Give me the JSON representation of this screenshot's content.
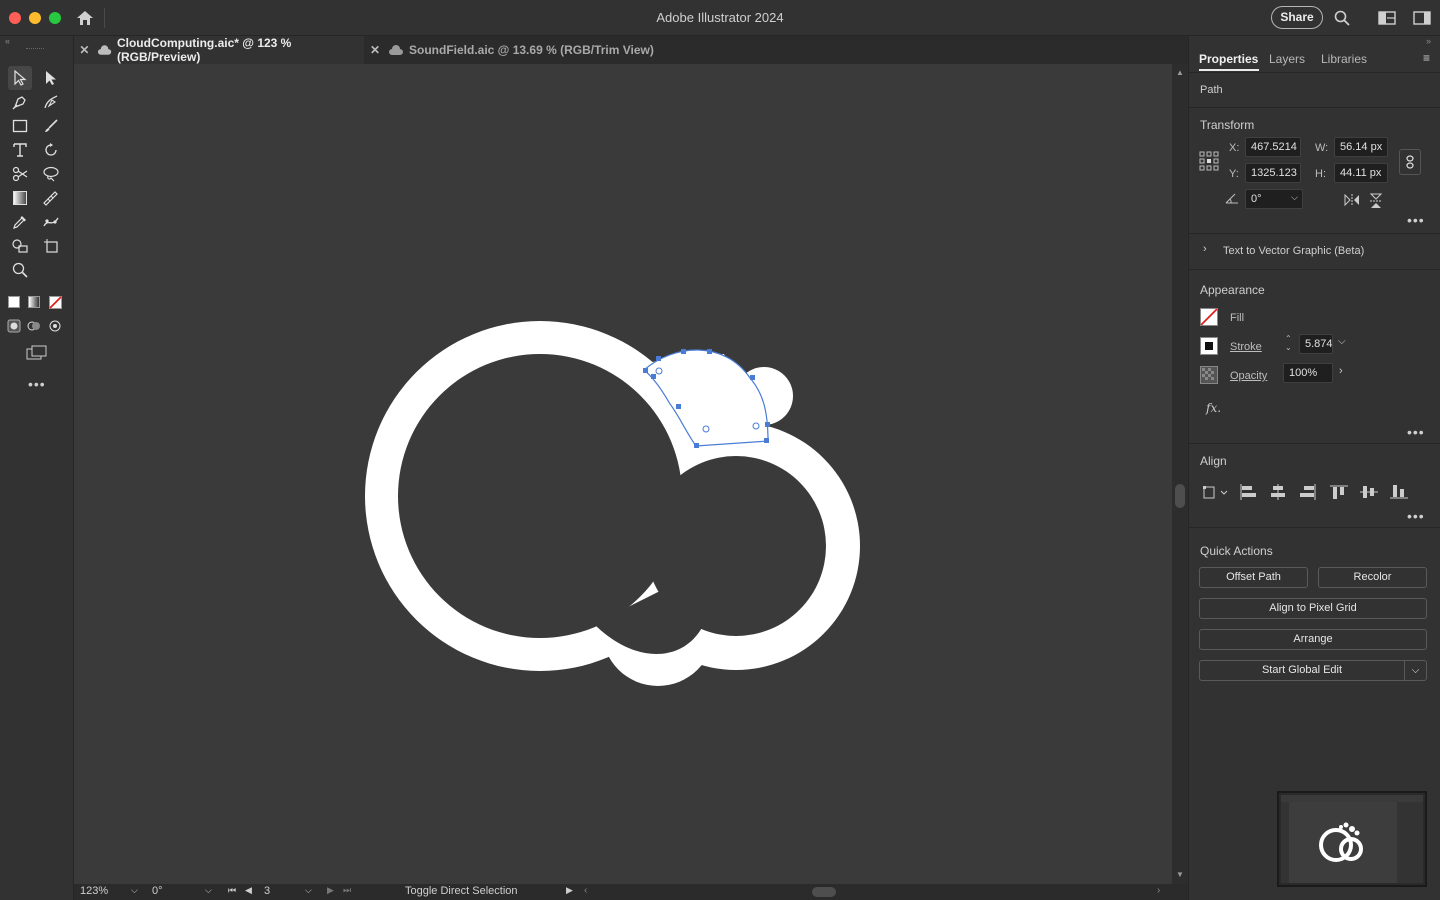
{
  "window": {
    "title": "Adobe Illustrator 2024",
    "share_label": "Share"
  },
  "tabs": [
    {
      "label": "CloudComputing.aic* @ 123 % (RGB/Preview)",
      "active": true
    },
    {
      "label": "SoundField.aic @ 13.69 % (RGB/Trim View)",
      "active": false
    }
  ],
  "panel": {
    "tabs": [
      "Properties",
      "Layers",
      "Libraries"
    ],
    "selection_type": "Path",
    "transform": {
      "title": "Transform",
      "x_label": "X:",
      "x": "467.5214",
      "y_label": "Y:",
      "y": "1325.123",
      "w_label": "W:",
      "w": "56.14 px",
      "h_label": "H:",
      "h": "44.11 px",
      "rotate": "0°"
    },
    "text_to_vector": "Text to Vector Graphic (Beta)",
    "appearance": {
      "title": "Appearance",
      "fill_label": "Fill",
      "stroke_label": "Stroke",
      "stroke_value": "5.874",
      "opacity_label": "Opacity",
      "opacity_value": "100%",
      "fx_label": "fx."
    },
    "align": {
      "title": "Align"
    },
    "quick_actions": {
      "title": "Quick Actions",
      "offset_path": "Offset Path",
      "recolor": "Recolor",
      "align_pixel": "Align to Pixel Grid",
      "arrange": "Arrange",
      "global_edit": "Start Global Edit"
    }
  },
  "status": {
    "zoom": "123%",
    "rotation": "0°",
    "artboard": "3",
    "tool_hint": "Toggle Direct Selection"
  },
  "colors": {
    "accent_selection": "#4a7cd6",
    "canvas": "#3a3a3a",
    "artwork": "#ffffff"
  }
}
